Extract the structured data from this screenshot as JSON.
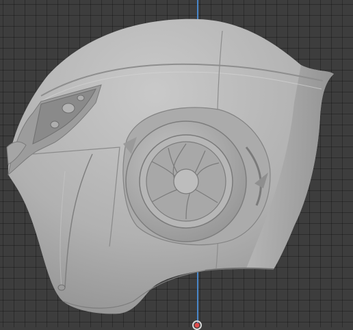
{
  "viewport": {
    "background_color": "#3d3d3d",
    "grid_color": "#333333",
    "axis_color": "#4a8fd8"
  },
  "model": {
    "object": "helmet",
    "shading": "solid-grey",
    "base_color": "#a9a9a9",
    "highlight_color": "#c8c8c8",
    "shadow_color": "#7b7b7b"
  },
  "icons": [
    "origin-cursor-icon"
  ]
}
